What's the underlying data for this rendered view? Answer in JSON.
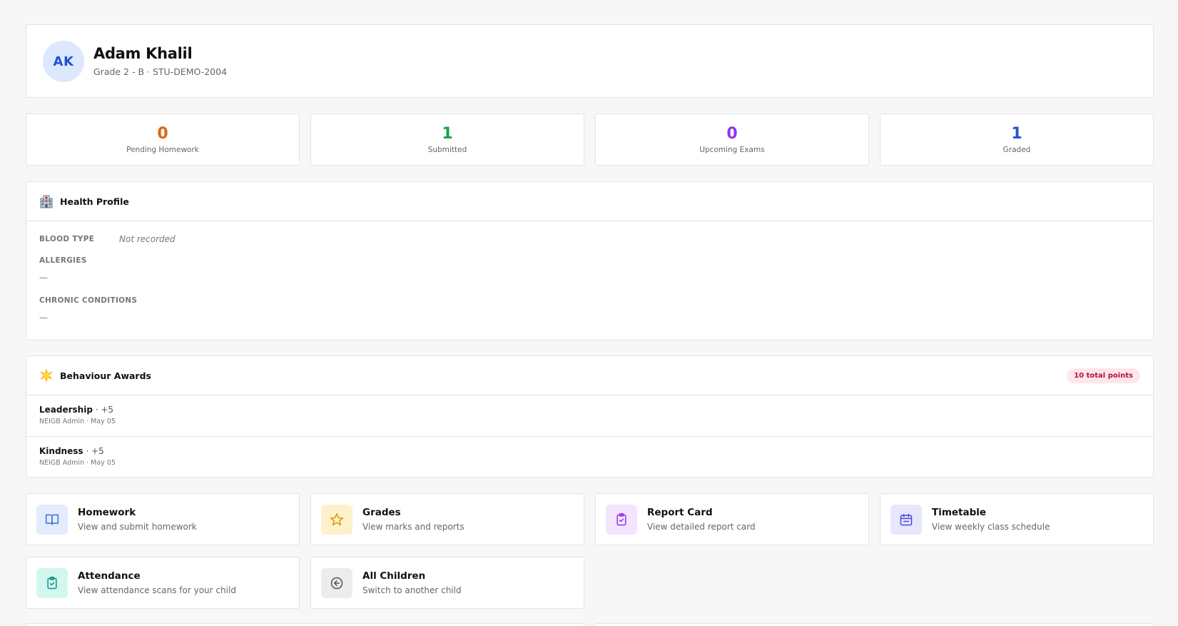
{
  "student": {
    "initials": "AK",
    "name": "Adam Khalil",
    "meta": "Grade 2 - B · STU-DEMO-2004"
  },
  "stats": [
    {
      "value": "0",
      "label": "Pending Homework",
      "color": "#e0660b"
    },
    {
      "value": "1",
      "label": "Submitted",
      "color": "#17a34a"
    },
    {
      "value": "0",
      "label": "Upcoming Exams",
      "color": "#9333ea"
    },
    {
      "value": "1",
      "label": "Graded",
      "color": "#2453d6"
    }
  ],
  "health": {
    "title": "Health Profile",
    "icon": "hospital-icon",
    "blood_type_label": "BLOOD TYPE",
    "blood_type_value": "Not recorded",
    "allergies_label": "ALLERGIES",
    "allergies_value": "—",
    "chronic_label": "CHRONIC CONDITIONS",
    "chronic_value": "—"
  },
  "awards": {
    "title": "Behaviour Awards",
    "icon": "star-burst-icon",
    "total_points": "10 total points",
    "items": [
      {
        "name": "Leadership",
        "points": " · +5",
        "meta": "NEIGB Admin · May 05"
      },
      {
        "name": "Kindness",
        "points": " · +5",
        "meta": "NEIGB Admin · May 05"
      }
    ]
  },
  "tiles": [
    {
      "title": "Homework",
      "desc": "View and submit homework",
      "icon": "book-icon",
      "bg": "#e3ecfd",
      "fg": "#3b6fd8"
    },
    {
      "title": "Grades",
      "desc": "View marks and reports",
      "icon": "star-icon",
      "bg": "#fdf1cc",
      "fg": "#d99a06"
    },
    {
      "title": "Report Card",
      "desc": "View detailed report card",
      "icon": "clipboard-check-icon",
      "bg": "#f3e5fd",
      "fg": "#9333ea"
    },
    {
      "title": "Timetable",
      "desc": "View weekly class schedule",
      "icon": "calendar-icon",
      "bg": "#e6e7fb",
      "fg": "#4f46e5"
    },
    {
      "title": "Attendance",
      "desc": "View attendance scans for your child",
      "icon": "clipboard-check-icon",
      "bg": "#d2f7ef",
      "fg": "#0d9488"
    },
    {
      "title": "All Children",
      "desc": "Switch to another child",
      "icon": "arrow-left-circle-icon",
      "bg": "#ececec",
      "fg": "#555555"
    }
  ]
}
